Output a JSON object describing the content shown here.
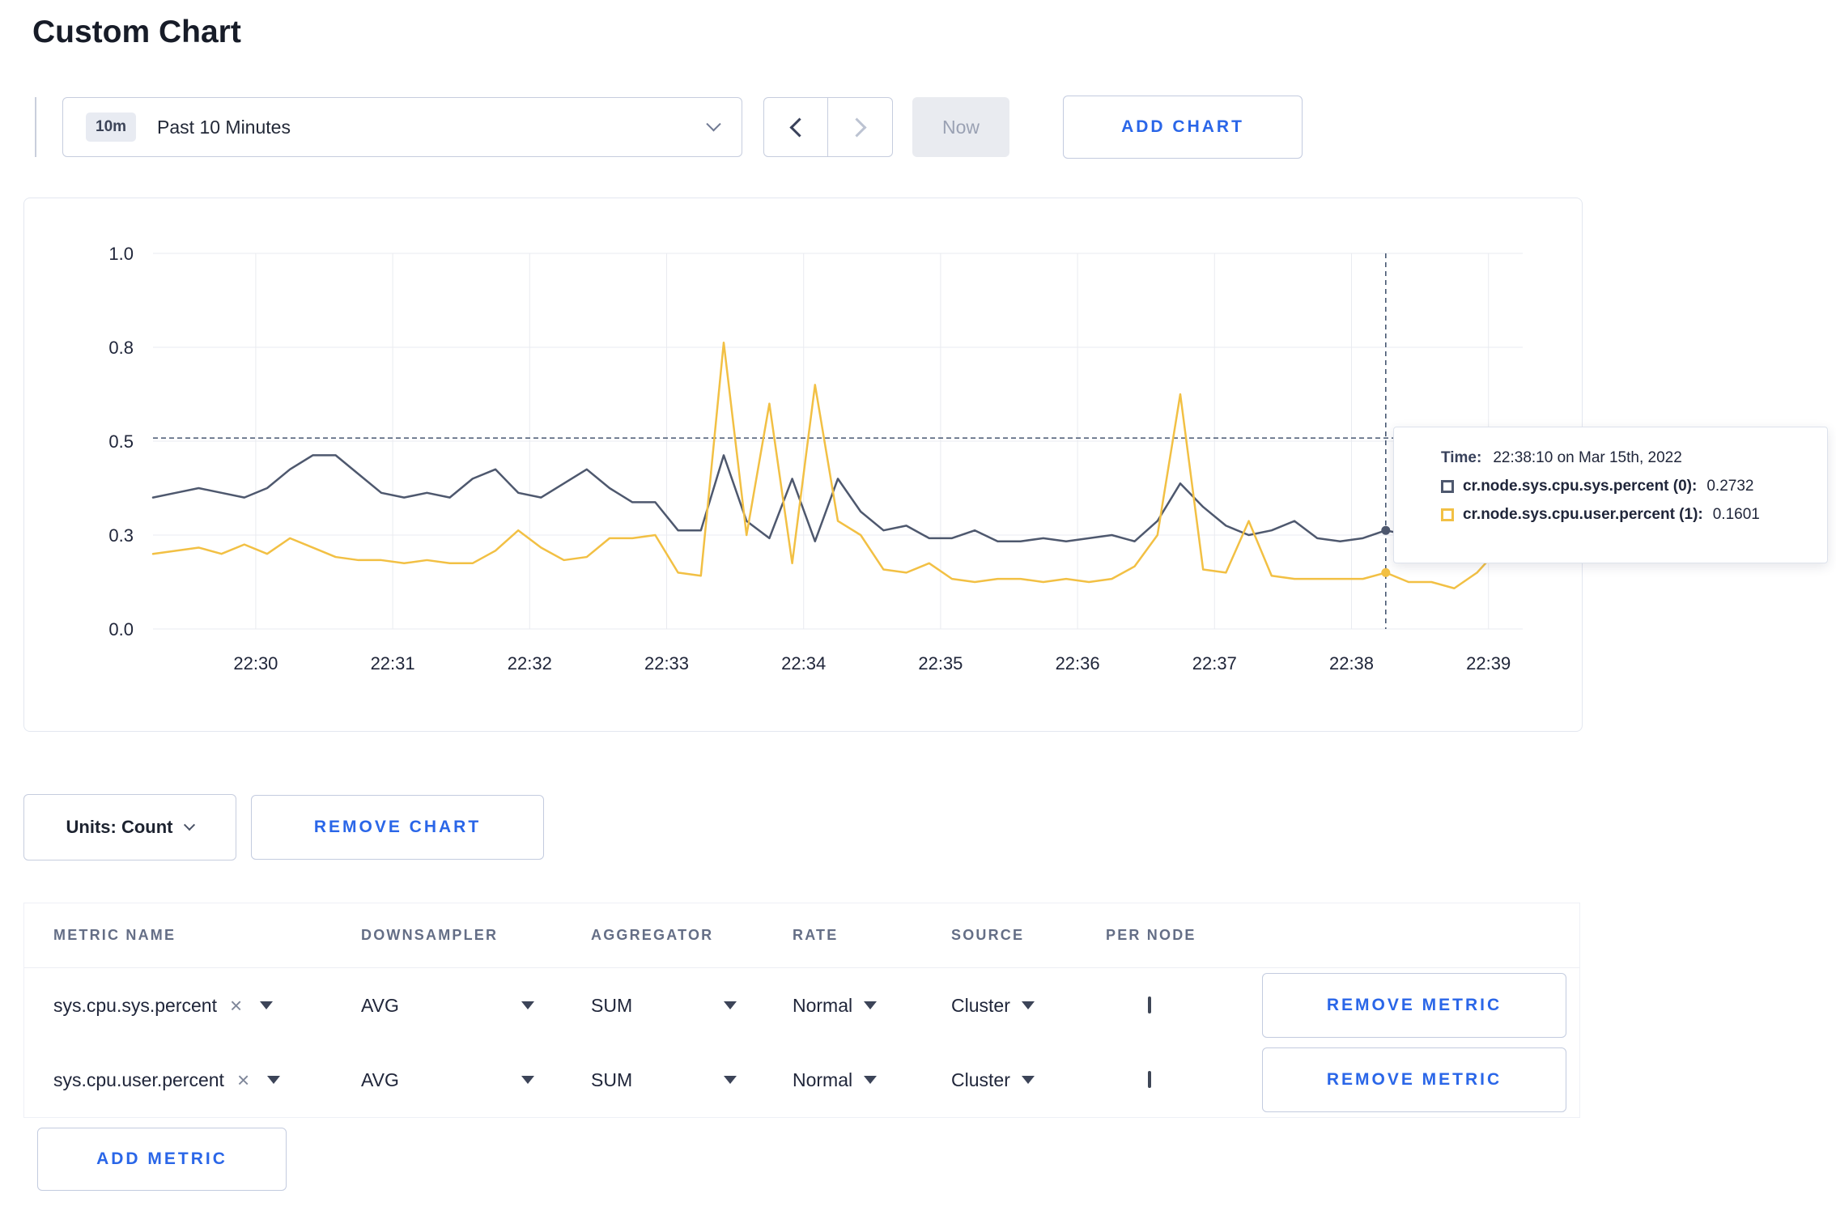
{
  "page": {
    "title": "Custom Chart"
  },
  "colors": {
    "accent_blue": "#2a66e8",
    "series_sys": "#4e586e",
    "series_user": "#f2c044",
    "crosshair": "#475872",
    "grid": "#e9ebf0",
    "axis_text": "#20263a"
  },
  "toolbar": {
    "time_badge": "10m",
    "time_label": "Past 10 Minutes",
    "now_label": "Now",
    "add_chart_label": "ADD CHART"
  },
  "chart": {
    "tooltip": {
      "time_label": "Time:",
      "time_value": "22:38:10 on Mar 15th, 2022",
      "series": [
        {
          "name": "cr.node.sys.cpu.sys.percent (0):",
          "value": "0.2732",
          "color": "#4e586e"
        },
        {
          "name": "cr.node.sys.cpu.user.percent (1):",
          "value": "0.1601",
          "color": "#f2c044"
        }
      ]
    }
  },
  "chart_data": {
    "type": "line",
    "title": "",
    "xlabel": "",
    "ylabel": "",
    "ylim": [
      0,
      1
    ],
    "grid": true,
    "x_tick_labels": [
      "22:30",
      "22:31",
      "22:32",
      "22:33",
      "22:34",
      "22:35",
      "22:36",
      "22:37",
      "22:38",
      "22:39"
    ],
    "x_tick_fractions": [
      0.075,
      0.175,
      0.275,
      0.375,
      0.475,
      0.575,
      0.675,
      0.775,
      0.875,
      0.975
    ],
    "y_ticks": [
      0,
      0.3,
      0.5,
      0.8,
      1.0
    ],
    "y_tick_labels": [
      "0.0",
      "0.3",
      "0.5",
      "0.8",
      "1.0"
    ],
    "guide_value": 0.51,
    "crosshair_index": 54,
    "crosshair_time": "22:38:10",
    "series": [
      {
        "name": "cr.node.sys.cpu.sys.percent",
        "color": "#4e586e",
        "values": [
          0.38,
          0.39,
          0.4,
          0.39,
          0.38,
          0.4,
          0.44,
          0.47,
          0.47,
          0.43,
          0.39,
          0.38,
          0.39,
          0.38,
          0.42,
          0.44,
          0.39,
          0.38,
          0.41,
          0.44,
          0.4,
          0.37,
          0.37,
          0.31,
          0.31,
          0.47,
          0.33,
          0.29,
          0.42,
          0.28,
          0.42,
          0.35,
          0.31,
          0.32,
          0.29,
          0.29,
          0.31,
          0.28,
          0.28,
          0.29,
          0.28,
          0.29,
          0.3,
          0.28,
          0.33,
          0.41,
          0.36,
          0.32,
          0.3,
          0.31,
          0.33,
          0.29,
          0.28,
          0.29,
          0.31,
          0.3,
          0.3,
          0.32,
          0.3,
          0.3,
          0.33
        ]
      },
      {
        "name": "cr.node.sys.cpu.user.percent",
        "color": "#f2c044",
        "values": [
          0.24,
          0.25,
          0.26,
          0.24,
          0.27,
          0.24,
          0.29,
          0.26,
          0.23,
          0.22,
          0.22,
          0.21,
          0.22,
          0.21,
          0.21,
          0.25,
          0.31,
          0.26,
          0.22,
          0.23,
          0.29,
          0.29,
          0.3,
          0.18,
          0.17,
          0.81,
          0.3,
          0.62,
          0.21,
          0.68,
          0.33,
          0.3,
          0.19,
          0.18,
          0.21,
          0.16,
          0.15,
          0.16,
          0.16,
          0.15,
          0.16,
          0.15,
          0.16,
          0.2,
          0.3,
          0.65,
          0.19,
          0.18,
          0.33,
          0.17,
          0.16,
          0.16,
          0.16,
          0.16,
          0.18,
          0.15,
          0.15,
          0.13,
          0.18,
          0.26,
          0.23
        ]
      }
    ]
  },
  "chart_controls": {
    "units_label": "Units: Count",
    "remove_chart_label": "REMOVE CHART"
  },
  "metrics_table": {
    "headers": [
      "METRIC NAME",
      "DOWNSAMPLER",
      "AGGREGATOR",
      "RATE",
      "SOURCE",
      "PER NODE"
    ],
    "rows": [
      {
        "metric": "sys.cpu.sys.percent",
        "downsampler": "AVG",
        "aggregator": "SUM",
        "rate": "Normal",
        "source": "Cluster",
        "per_node_checked": false,
        "remove_label": "REMOVE METRIC"
      },
      {
        "metric": "sys.cpu.user.percent",
        "downsampler": "AVG",
        "aggregator": "SUM",
        "rate": "Normal",
        "source": "Cluster",
        "per_node_checked": false,
        "remove_label": "REMOVE METRIC"
      }
    ],
    "add_metric_label": "ADD METRIC"
  }
}
